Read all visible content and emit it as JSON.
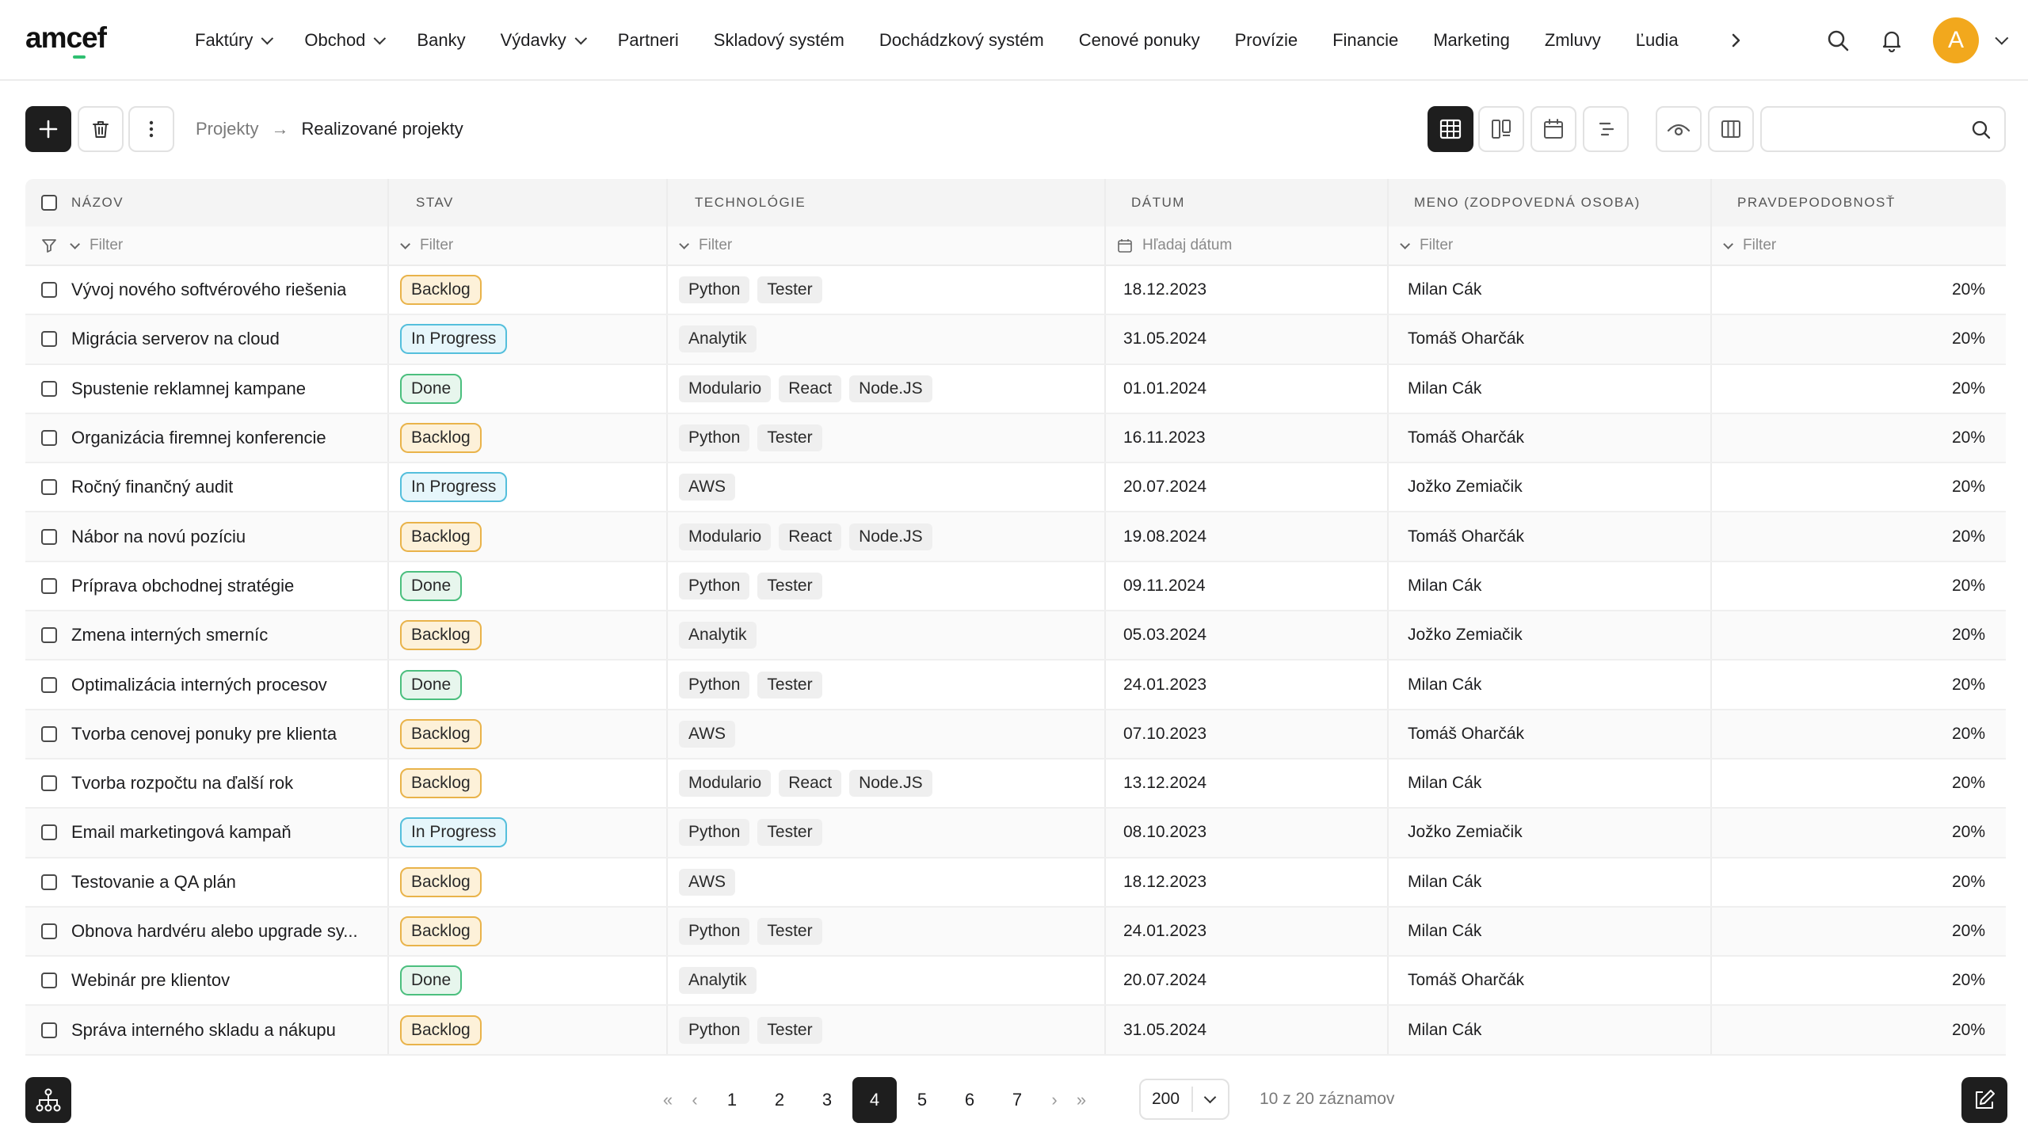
{
  "app": {
    "logo": "amcef"
  },
  "nav": {
    "items": [
      {
        "label": "Faktúry",
        "dropdown": true
      },
      {
        "label": "Obchod",
        "dropdown": true
      },
      {
        "label": "Banky",
        "dropdown": false
      },
      {
        "label": "Výdavky",
        "dropdown": true
      },
      {
        "label": "Partneri",
        "dropdown": false
      },
      {
        "label": "Skladový systém",
        "dropdown": false
      },
      {
        "label": "Dochádzkový systém",
        "dropdown": false
      },
      {
        "label": "Cenové ponuky",
        "dropdown": false
      },
      {
        "label": "Provízie",
        "dropdown": false
      },
      {
        "label": "Financie",
        "dropdown": false
      },
      {
        "label": "Marketing",
        "dropdown": false
      },
      {
        "label": "Zmluvy",
        "dropdown": false
      },
      {
        "label": "Ľudia",
        "dropdown": false
      }
    ],
    "avatar_initial": "A"
  },
  "breadcrumb": {
    "parent": "Projekty",
    "separator": "→",
    "current": "Realizované projekty"
  },
  "search": {
    "value": "",
    "placeholder": ""
  },
  "table": {
    "headers": {
      "name": "Názov",
      "stav": "Stav",
      "tech": "Technológie",
      "date": "Dátum",
      "meno": "Meno (zodpovedná osoba)",
      "prob": "Pravdepodobnosť"
    },
    "filters": {
      "name": "Filter",
      "stav": "Filter",
      "tech": "Filter",
      "date": "Hľadaj dátum",
      "meno": "Filter",
      "prob": "Filter"
    },
    "rows": [
      {
        "name": "Vývoj nového softvérového riešenia",
        "status": "Backlog",
        "status_type": "backlog",
        "tech": [
          "Python",
          "Tester"
        ],
        "date": "18.12.2023",
        "person": "Milan Cák",
        "prob": "20%"
      },
      {
        "name": "Migrácia serverov na cloud",
        "status": "In Progress",
        "status_type": "progress",
        "tech": [
          "Analytik"
        ],
        "date": "31.05.2024",
        "person": "Tomáš Oharčák",
        "prob": "20%"
      },
      {
        "name": "Spustenie reklamnej kampane",
        "status": "Done",
        "status_type": "done",
        "tech": [
          "Modulario",
          "React",
          "Node.JS"
        ],
        "date": "01.01.2024",
        "person": "Milan Cák",
        "prob": "20%"
      },
      {
        "name": "Organizácia firemnej konferencie",
        "status": "Backlog",
        "status_type": "backlog",
        "tech": [
          "Python",
          "Tester"
        ],
        "date": "16.11.2023",
        "person": "Tomáš Oharčák",
        "prob": "20%"
      },
      {
        "name": "Ročný finančný audit",
        "status": "In Progress",
        "status_type": "progress",
        "tech": [
          "AWS"
        ],
        "date": "20.07.2024",
        "person": "Jožko Zemiačik",
        "prob": "20%"
      },
      {
        "name": "Nábor na novú pozíciu",
        "status": "Backlog",
        "status_type": "backlog",
        "tech": [
          "Modulario",
          "React",
          "Node.JS"
        ],
        "date": "19.08.2024",
        "person": "Tomáš Oharčák",
        "prob": "20%"
      },
      {
        "name": "Príprava obchodnej stratégie",
        "status": "Done",
        "status_type": "done",
        "tech": [
          "Python",
          "Tester"
        ],
        "date": "09.11.2024",
        "person": "Milan Cák",
        "prob": "20%"
      },
      {
        "name": "Zmena interných smerníc",
        "status": "Backlog",
        "status_type": "backlog",
        "tech": [
          "Analytik"
        ],
        "date": "05.03.2024",
        "person": "Jožko Zemiačik",
        "prob": "20%"
      },
      {
        "name": "Optimalizácia interných procesov",
        "status": "Done",
        "status_type": "done",
        "tech": [
          "Python",
          "Tester"
        ],
        "date": "24.01.2023",
        "person": "Milan Cák",
        "prob": "20%"
      },
      {
        "name": "Tvorba cenovej ponuky pre klienta",
        "status": "Backlog",
        "status_type": "backlog",
        "tech": [
          "AWS"
        ],
        "date": "07.10.2023",
        "person": "Tomáš Oharčák",
        "prob": "20%"
      },
      {
        "name": "Tvorba rozpočtu na ďalší rok",
        "status": "Backlog",
        "status_type": "backlog",
        "tech": [
          "Modulario",
          "React",
          "Node.JS"
        ],
        "date": "13.12.2024",
        "person": "Milan Cák",
        "prob": "20%"
      },
      {
        "name": "Email marketingová kampaň",
        "status": "In Progress",
        "status_type": "progress",
        "tech": [
          "Python",
          "Tester"
        ],
        "date": "08.10.2023",
        "person": "Jožko Zemiačik",
        "prob": "20%"
      },
      {
        "name": "Testovanie a QA plán",
        "status": "Backlog",
        "status_type": "backlog",
        "tech": [
          "AWS"
        ],
        "date": "18.12.2023",
        "person": "Milan Cák",
        "prob": "20%"
      },
      {
        "name": "Obnova hardvéru alebo upgrade sy...",
        "status": "Backlog",
        "status_type": "backlog",
        "tech": [
          "Python",
          "Tester"
        ],
        "date": "24.01.2023",
        "person": "Milan Cák",
        "prob": "20%"
      },
      {
        "name": "Webinár pre klientov",
        "status": "Done",
        "status_type": "done",
        "tech": [
          "Analytik"
        ],
        "date": "20.07.2024",
        "person": "Tomáš Oharčák",
        "prob": "20%"
      },
      {
        "name": "Správa interného skladu a nákupu",
        "status": "Backlog",
        "status_type": "backlog",
        "tech": [
          "Python",
          "Tester"
        ],
        "date": "31.05.2024",
        "person": "Milan Cák",
        "prob": "20%"
      }
    ]
  },
  "pagination": {
    "pages": [
      "1",
      "2",
      "3",
      "4",
      "5",
      "6",
      "7"
    ],
    "current": "4",
    "page_size": "200",
    "records": "10 z 20 záznamov"
  }
}
